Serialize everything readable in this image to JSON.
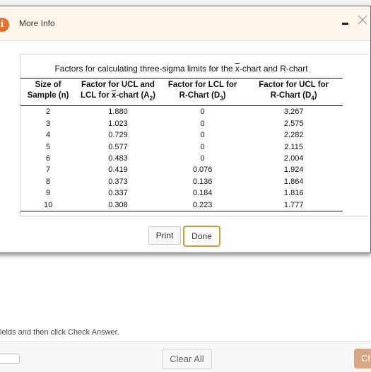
{
  "dialog": {
    "title": "More Info",
    "info_icon": "i"
  },
  "table": {
    "caption": "Factors for calculating three-sigma limits for the x-chart and R-chart",
    "headers": [
      [
        "Size of",
        "Sample (n)"
      ],
      [
        "Factor for UCL and",
        "LCL for x-chart (A2)"
      ],
      [
        "Factor for LCL for",
        "R-Chart (D3)"
      ],
      [
        "Factor for UCL for",
        "R-Chart (D4)"
      ]
    ],
    "rows": [
      [
        "2",
        "1.880",
        "0",
        "3.267"
      ],
      [
        "3",
        "1.023",
        "0",
        "2.575"
      ],
      [
        "4",
        "0.729",
        "0",
        "2.282"
      ],
      [
        "5",
        "0.577",
        "0",
        "2.115"
      ],
      [
        "6",
        "0.483",
        "0",
        "2.004"
      ],
      [
        "7",
        "0.419",
        "0.076",
        "1.924"
      ],
      [
        "8",
        "0.373",
        "0.136",
        "1.864"
      ],
      [
        "9",
        "0.337",
        "0.184",
        "1.816"
      ],
      [
        "10",
        "0.308",
        "0.223",
        "1.777"
      ]
    ]
  },
  "buttons": {
    "print": "Print",
    "done": "Done"
  },
  "page": {
    "instructions": "ields and then click Check Answer.",
    "clear_all": "Clear All",
    "check_answer": "Ch"
  }
}
